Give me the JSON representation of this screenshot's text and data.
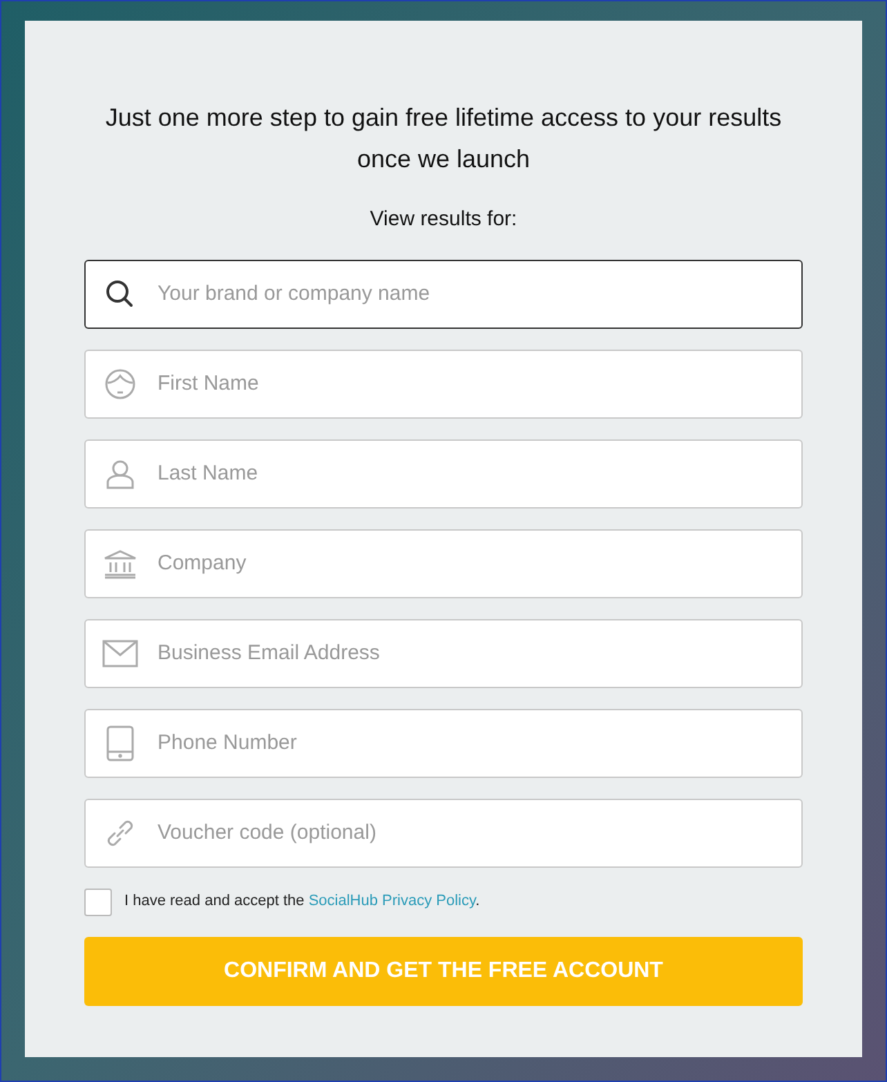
{
  "heading": "Just one more step to gain free lifetime access to your results once we launch",
  "subheading": "View results for:",
  "fields": [
    {
      "kind": "search",
      "placeholder": "Your brand or company name",
      "focused": true
    },
    {
      "kind": "face",
      "placeholder": "First Name",
      "focused": false
    },
    {
      "kind": "person",
      "placeholder": "Last Name",
      "focused": false
    },
    {
      "kind": "bank",
      "placeholder": "Company",
      "focused": false
    },
    {
      "kind": "mail",
      "placeholder": "Business Email Address",
      "focused": false
    },
    {
      "kind": "phone",
      "placeholder": "Phone Number",
      "focused": false
    },
    {
      "kind": "link",
      "placeholder": "Voucher code (optional)",
      "focused": false
    }
  ],
  "consent": {
    "checked": false,
    "text": "I have read and accept the ",
    "link": "SocialHub Privacy Policy",
    "suffix": "."
  },
  "submit": "CONFIRM AND GET THE FREE ACCOUNT"
}
